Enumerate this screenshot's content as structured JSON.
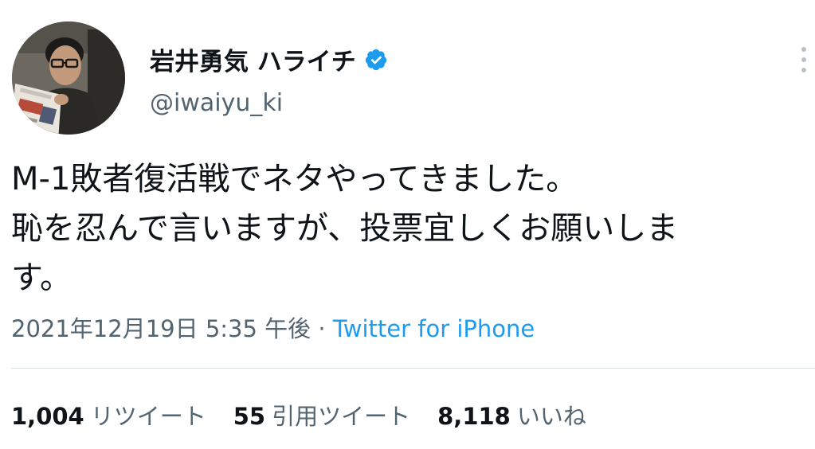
{
  "author": {
    "display_name": "岩井勇気 ハライチ",
    "handle": "@iwaiyu_ki",
    "verified": true
  },
  "tweet": {
    "lines": [
      "M-1敗者復活戦でネタやってきました。",
      "恥を忍んで言いますが、投票宜しくお願いしま",
      "す。"
    ],
    "timestamp": "2021年12月19日 5:35 午後",
    "separator": "·",
    "source": "Twitter for iPhone"
  },
  "stats": {
    "retweets": {
      "count": "1,004",
      "label": "リツイート"
    },
    "quotes": {
      "count": "55",
      "label": "引用ツイート"
    },
    "likes": {
      "count": "8,118",
      "label": "いいね"
    }
  },
  "icons": {
    "verified": "verified-badge-icon",
    "more": "more-vertical-icon"
  },
  "colors": {
    "verified_blue": "#1d9bf0",
    "link_blue": "#1d9bf0",
    "secondary_text": "#536471",
    "primary_text": "#0f1419"
  }
}
